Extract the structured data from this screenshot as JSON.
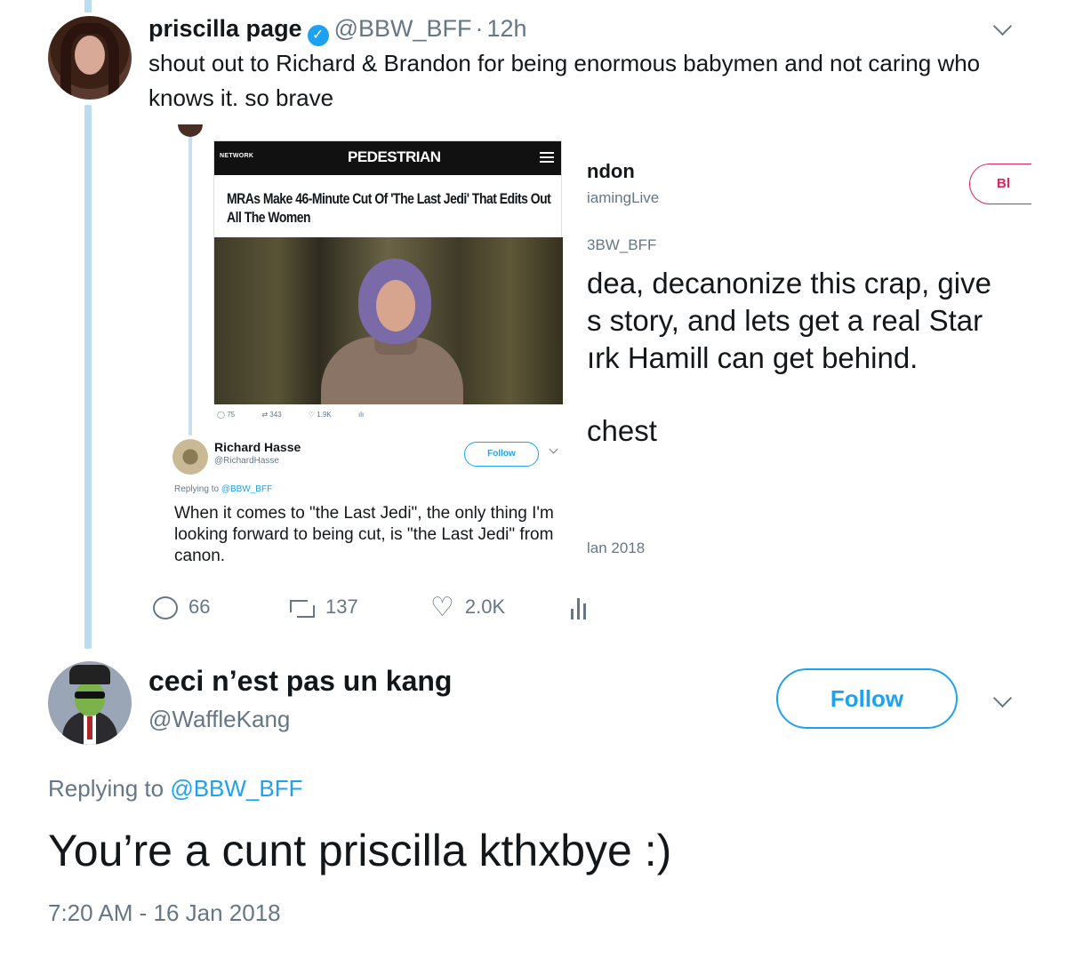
{
  "tweet1": {
    "name": "priscilla page",
    "handle": "@BBW_BFF",
    "separator": "·",
    "time": "12h",
    "text": "shout out to Richard & Brandon for being enormous babymen and not caring who knows it. so brave",
    "icons": {
      "avatar": "avatar",
      "verified": "verified-badge-icon",
      "more": "chevron-down-icon"
    },
    "embed": {
      "article": {
        "network": "NETWORK",
        "logo": "PEDESTRIAN",
        "headline": "MRAs Make 46-Minute Cut Of 'The Last Jedi' That Edits Out All The Women"
      },
      "mini_stats": {
        "replies": "75",
        "retweets": "343",
        "likes": "1.9K"
      },
      "reply": {
        "name": "Richard Hasse",
        "handle": "@RichardHasse",
        "follow_label": "Follow",
        "replying_prefix": "Replying to",
        "replying_handle": "@BBW_BFF",
        "text": "When it comes to \"the Last Jedi\", the only thing I'm looking forward to being cut, is \"the Last Jedi\" from canon."
      },
      "right_fragment": {
        "name": "ndon",
        "handle": "iamingLive",
        "block_label": "Bl",
        "replying": "3BW_BFF",
        "body_line1": "dea, decanonize this crap, give",
        "body_line2": "s story, and lets get a real Star",
        "body_line3": "ırk Hamill can get behind.",
        "line_chest": "chest",
        "date": "lan 2018"
      }
    },
    "actions": {
      "replies": "66",
      "retweets": "137",
      "likes": "2.0K"
    }
  },
  "tweet2": {
    "name": "ceci n’est pas un kang",
    "handle": "@WaffleKang",
    "follow_label": "Follow",
    "replying_prefix": "Replying to",
    "replying_handle": "@BBW_BFF",
    "text": "You’re a cunt priscilla kthxbye :)",
    "timestamp": "7:20 AM - 16 Jan 2018"
  },
  "colors": {
    "accent": "#1da1f2",
    "muted": "#657786",
    "block": "#e0245e",
    "thread_line": "#bcdcf0"
  }
}
